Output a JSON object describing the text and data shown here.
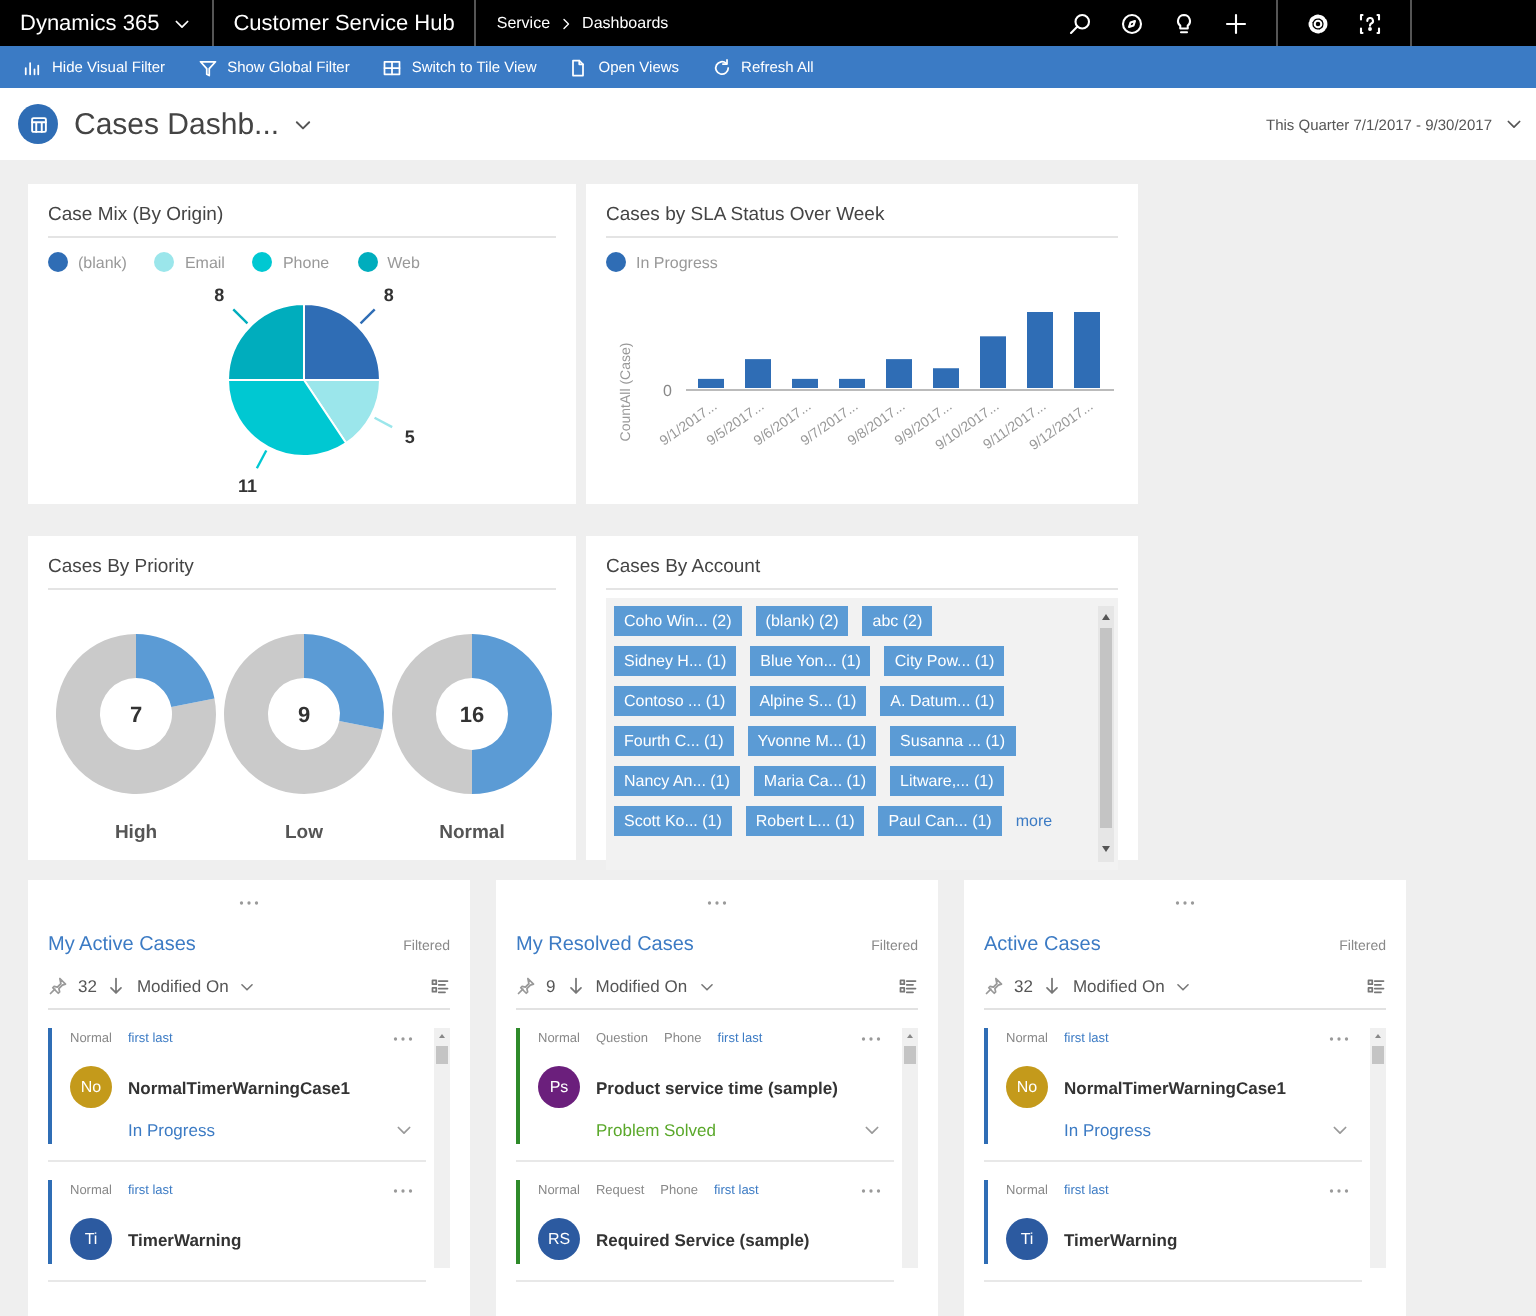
{
  "top_bar": {
    "app_name": "Dynamics 365",
    "app_title": "Customer Service Hub",
    "breadcrumb": [
      "Service",
      "Dashboards"
    ]
  },
  "command_bar": [
    {
      "label": "Hide Visual Filter",
      "kind": "visual"
    },
    {
      "label": "Show Global Filter",
      "kind": "filter"
    },
    {
      "label": "Switch to Tile View",
      "kind": "tile"
    },
    {
      "label": "Open Views",
      "kind": "views"
    },
    {
      "label": "Refresh All",
      "kind": "refresh"
    }
  ],
  "header": {
    "title": "Cases Dashb...",
    "period": "This Quarter 7/1/2017 - 9/30/2017"
  },
  "case_mix": {
    "legend": [
      {
        "color": "#2f6db5"
      },
      {
        "color": "#9be6eb"
      },
      {
        "color": "#00c8d2"
      },
      {
        "color": "#00adbd"
      }
    ],
    "chart_data": {
      "type": "pie",
      "title": "Case Mix (By Origin)",
      "categories": [
        "(blank)",
        "Email",
        "Phone",
        "Web"
      ],
      "values": [
        8,
        5,
        11,
        8
      ],
      "data_labels": true
    }
  },
  "sla_chart": {
    "title": "Cases by SLA Status Over Week",
    "legend": [
      {
        "label": "In Progress",
        "color": "#2f6db5"
      }
    ],
    "y_axis_label": "CountAll (Case)",
    "y_tick": "0",
    "x_labels": [
      "9/1/2017...",
      "9/5/2017...",
      "9/6/2017...",
      "9/7/2017...",
      "9/8/2017...",
      "9/9/2017...",
      "9/10/2017...",
      "9/11/2017...",
      "9/12/2017..."
    ]
  },
  "priority": {
    "title": "Cases By Priority",
    "gauges": [
      {
        "label": "High",
        "value": "7"
      },
      {
        "label": "Low",
        "value": "9"
      },
      {
        "label": "Normal",
        "value": "16"
      }
    ]
  },
  "accounts": {
    "title": "Cases By Account",
    "tags": [
      "Coho Win... (2)",
      "(blank) (2)",
      "abc (2)",
      "Sidney H... (1)",
      "Blue Yon... (1)",
      "City Pow... (1)",
      "Contoso ... (1)",
      "Alpine S... (1)",
      "A. Datum... (1)",
      "Fourth C... (1)",
      "Yvonne M... (1)",
      "Susanna ... (1)",
      "Nancy An... (1)",
      "Maria Ca... (1)",
      "Litware,... (1)",
      "Scott Ko... (1)",
      "Robert L... (1)",
      "Paul Can... (1)"
    ],
    "more_link": "more"
  },
  "lists": [
    {
      "title": "My Active Cases",
      "filter_note": "Filtered",
      "count": "32",
      "sort_field": "Modified On",
      "items": [
        {
          "color": "#2f6db5",
          "meta": [
            {
              "text": "Normal",
              "kind": "field"
            },
            {
              "text": "first last",
              "kind": "owner"
            }
          ],
          "avatar": {
            "initials": "No",
            "color": "#c49a1b"
          },
          "name": "NormalTimerWarningCase1",
          "status": {
            "text": "In Progress",
            "color": "#3c7bc4"
          }
        },
        {
          "color": "#2f6db5",
          "meta": [
            {
              "text": "Normal",
              "kind": "field"
            },
            {
              "text": "first last",
              "kind": "owner"
            }
          ],
          "avatar": {
            "initials": "Ti",
            "color": "#2c5aa0"
          },
          "name": "TimerWarning"
        }
      ]
    },
    {
      "title": "My Resolved Cases",
      "filter_note": "Filtered",
      "count": "9",
      "sort_field": "Modified On",
      "items": [
        {
          "color": "#2e8a2a",
          "meta": [
            {
              "text": "Normal",
              "kind": "field"
            },
            {
              "text": "Question",
              "kind": "field"
            },
            {
              "text": "Phone",
              "kind": "field"
            },
            {
              "text": "first last",
              "kind": "owner"
            }
          ],
          "avatar": {
            "initials": "Ps",
            "color": "#6b1f7c"
          },
          "name": "Product service time (sample)",
          "status": {
            "text": "Problem Solved",
            "color": "#5aa82a"
          }
        },
        {
          "color": "#2e8a2a",
          "meta": [
            {
              "text": "Normal",
              "kind": "field"
            },
            {
              "text": "Request",
              "kind": "field"
            },
            {
              "text": "Phone",
              "kind": "field"
            },
            {
              "text": "first last",
              "kind": "owner"
            }
          ],
          "avatar": {
            "initials": "RS",
            "color": "#2c5aa0"
          },
          "name": "Required Service (sample)"
        }
      ]
    },
    {
      "title": "Active Cases",
      "filter_note": "Filtered",
      "count": "32",
      "sort_field": "Modified On",
      "items": [
        {
          "color": "#2f6db5",
          "meta": [
            {
              "text": "Normal",
              "kind": "field"
            },
            {
              "text": "first last",
              "kind": "owner"
            }
          ],
          "avatar": {
            "initials": "No",
            "color": "#c49a1b"
          },
          "name": "NormalTimerWarningCase1",
          "status": {
            "text": "In Progress",
            "color": "#3c7bc4"
          }
        },
        {
          "color": "#2f6db5",
          "meta": [
            {
              "text": "Normal",
              "kind": "field"
            },
            {
              "text": "first last",
              "kind": "owner"
            }
          ],
          "avatar": {
            "initials": "Ti",
            "color": "#2c5aa0"
          },
          "name": "TimerWarning"
        }
      ]
    }
  ]
}
